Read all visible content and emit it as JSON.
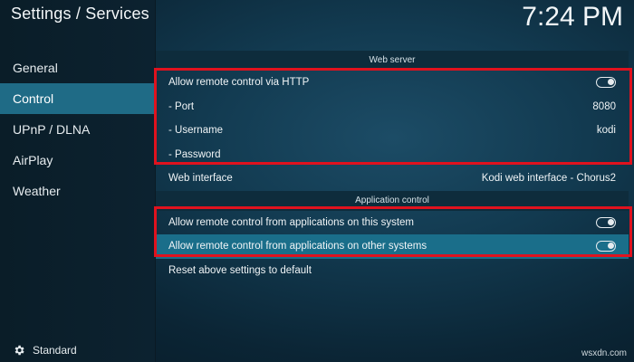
{
  "header": {
    "title": "Settings / Services",
    "clock": "7:24 PM"
  },
  "sidebar": {
    "items": [
      {
        "label": "General"
      },
      {
        "label": "Control"
      },
      {
        "label": "UPnP / DLNA"
      },
      {
        "label": "AirPlay"
      },
      {
        "label": "Weather"
      }
    ],
    "active_index": 1,
    "footer_label": "Standard"
  },
  "web_server": {
    "header": "Web server",
    "http_label": "Allow remote control via HTTP",
    "http_enabled": true,
    "port_label": "- Port",
    "port_value": "8080",
    "username_label": "- Username",
    "username_value": "kodi",
    "password_label": "- Password",
    "web_interface_label": "Web interface",
    "web_interface_value": "Kodi web interface - Chorus2"
  },
  "application_control": {
    "header": "Application control",
    "this_system_label": "Allow remote control from applications on this system",
    "this_system_enabled": true,
    "other_systems_label": "Allow remote control from applications on other systems",
    "other_systems_enabled": true,
    "reset_label": "Reset above settings to default"
  },
  "watermark": "wsxdn.com",
  "colors": {
    "accent": "#1f6b86",
    "highlight_box": "#e0121e"
  }
}
